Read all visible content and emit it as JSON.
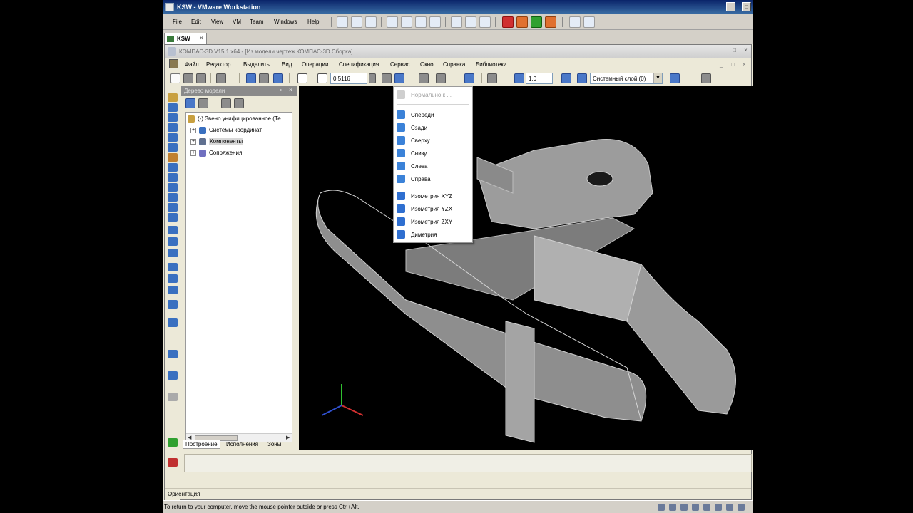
{
  "vmware": {
    "title": "KSW - VMware Workstation",
    "menu": [
      "File",
      "Edit",
      "View",
      "VM",
      "Team",
      "Windows",
      "Help"
    ],
    "tab_label": "KSW",
    "tab_close": "×",
    "status_text": "To return to your computer, move the mouse pointer outside or press Ctrl+Alt."
  },
  "kompas": {
    "title": "КОМПАС-3D V15.1 x64 - [Из модели чертеж КОМПАС-3D Сборка]",
    "menu": [
      "Файл",
      "Редактор",
      "Выделить",
      "Вид",
      "Операции",
      "Спецификация",
      "Сервис",
      "Окно",
      "Справка",
      "Библиотеки"
    ],
    "zoom_value": "0.5116",
    "step_value": "1.0",
    "layer_value": "Системный слой (0)",
    "status_text": "Ориентация"
  },
  "tree": {
    "header": "Дерево модели",
    "root": "(-) Звено унифицированное (Те",
    "items": [
      "Системы координат",
      "Компоненты",
      "Сопряжения"
    ],
    "tabs": [
      "Построение",
      "Исполнения",
      "Зоны"
    ]
  },
  "orientation_menu": {
    "header": "Нормально к ...",
    "group1": [
      "Спереди",
      "Сзади",
      "Сверху",
      "Снизу",
      "Слева",
      "Справа"
    ],
    "group2": [
      "Изометрия XYZ",
      "Изометрия YZX",
      "Изометрия ZXY",
      "Диметрия"
    ]
  },
  "colors": {
    "vm_title": "#0a246a",
    "viewport_bg": "#000000",
    "model_gray": "#a9a9a9",
    "menu_icon_blue": "#2f6fd0"
  }
}
